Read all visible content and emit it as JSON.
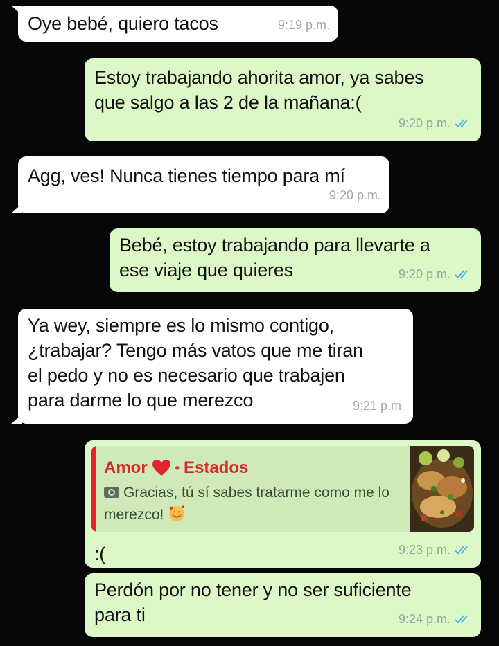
{
  "messages": [
    {
      "text": "Oye bebé, quiero tacos",
      "time": "9:19 p.m."
    },
    {
      "text": "Estoy trabajando ahorita amor, ya sabes\nque salgo a las 2 de la mañana:(",
      "time": "9:20 p.m."
    },
    {
      "text": "Agg, ves! Nunca tienes tiempo para mí",
      "time": "9:20 p.m."
    },
    {
      "text": "Bebé, estoy trabajando para llevarte a\nese viaje que quieres",
      "time": "9:20 p.m."
    },
    {
      "text": "Ya wey, siempre es lo mismo contigo,\n¿trabajar? Tengo más vatos que me tiran\nel pedo y no es necesario que trabajen\npara darme lo que merezco",
      "time": "9:21 p.m."
    },
    {
      "text": ":(",
      "time": "9:23 p.m.",
      "quote": {
        "name": "Amor",
        "separator": "•",
        "label": "Estados",
        "text": "Gracias, tú sí sabes tratarme como me lo merezco!"
      }
    },
    {
      "text": "Perdón por no tener y no ser suficiente\npara ti",
      "time": "9:24 p.m."
    }
  ],
  "colors": {
    "background": "#060606",
    "incoming_bubble": "#ffffff",
    "outgoing_bubble": "#dcf8c6",
    "read_ticks": "#4fb6ec",
    "quote_accent": "#e0262b"
  },
  "icons": {
    "read_receipt": "double-check-icon",
    "heart": "red-heart-icon",
    "camera": "camera-icon",
    "emoji": "smiling-face-with-hearts-icon"
  }
}
